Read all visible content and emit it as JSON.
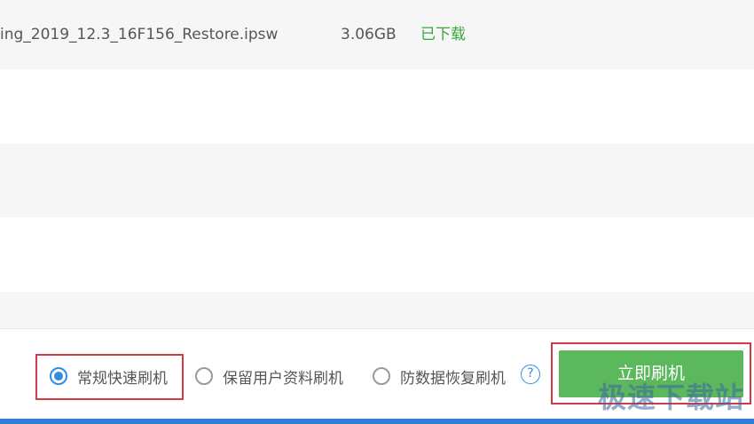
{
  "file_list": {
    "rows": [
      {
        "name": "ing_2019_12.3_16F156_Restore.ipsw",
        "size": "3.06GB",
        "status": "已下载"
      }
    ]
  },
  "flash_modes": {
    "options": [
      {
        "label": "常规快速刷机",
        "selected": true
      },
      {
        "label": "保留用户资料刷机",
        "selected": false
      },
      {
        "label": "防数据恢复刷机",
        "selected": false
      }
    ],
    "help_icon": "question-circle-icon",
    "help_glyph": "?"
  },
  "actions": {
    "flash_now_label": "立即刷机"
  },
  "watermark": {
    "text": "极速下载站"
  },
  "colors": {
    "accent_blue": "#2f8de4",
    "status_green": "#3aa63a",
    "button_green": "#5cb85c",
    "highlight_red": "#d23b45",
    "stripe": "#f6f6f6"
  }
}
